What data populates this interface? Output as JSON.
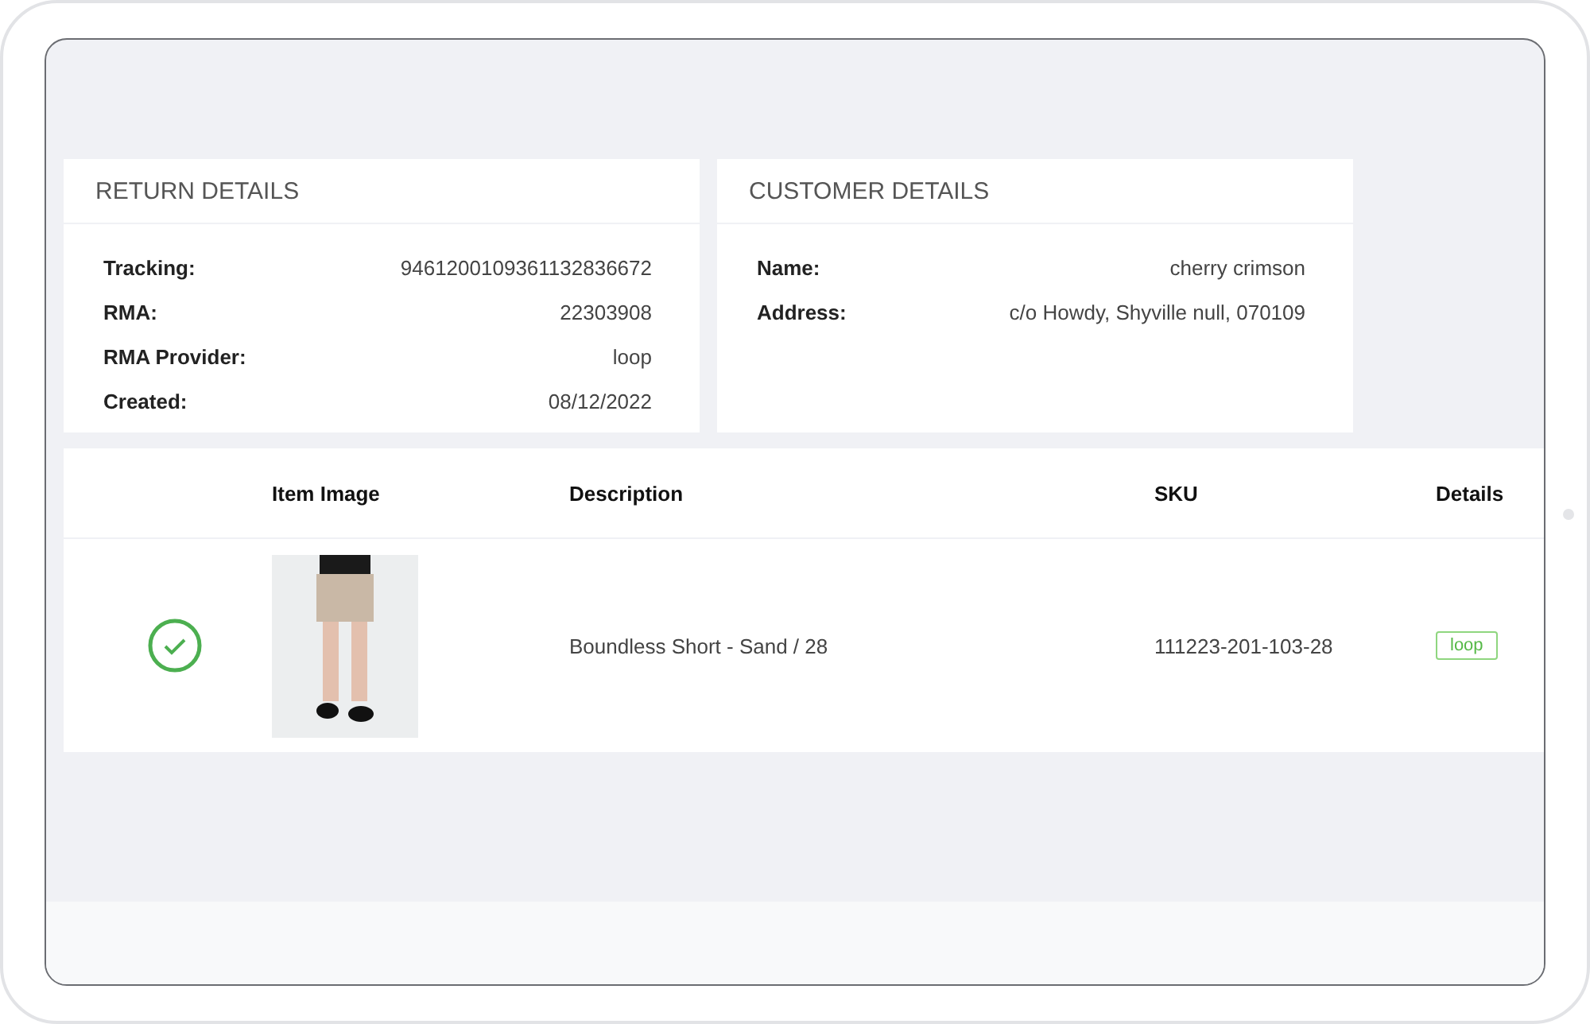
{
  "return_details": {
    "title": "RETURN DETAILS",
    "fields": [
      {
        "label": "Tracking:",
        "value": "9461200109361132836672"
      },
      {
        "label": "RMA:",
        "value": "22303908"
      },
      {
        "label": "RMA Provider:",
        "value": "loop"
      },
      {
        "label": "Created:",
        "value": "08/12/2022"
      }
    ]
  },
  "customer_details": {
    "title": "CUSTOMER DETAILS",
    "fields": [
      {
        "label": "Name:",
        "value": "cherry crimson"
      },
      {
        "label": "Address:",
        "value": "c/o Howdy, Shyville null, 070109"
      }
    ]
  },
  "items_table": {
    "columns": [
      "Item Image",
      "Description",
      "SKU",
      "Details"
    ],
    "rows": [
      {
        "checked": true,
        "description": "Boundless Short - Sand / 28",
        "sku": "111223-201-103-28",
        "details_tag": "loop"
      }
    ]
  }
}
